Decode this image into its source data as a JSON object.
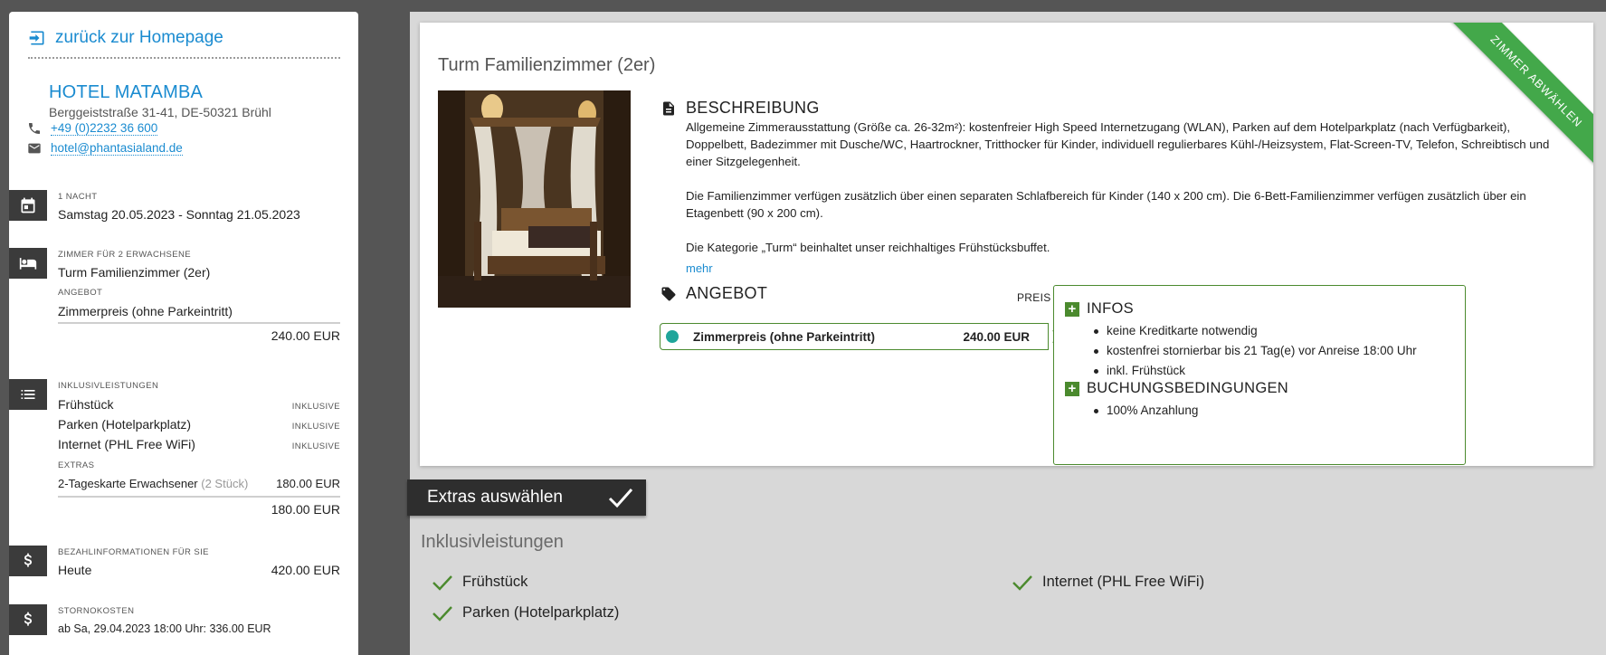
{
  "sidebar": {
    "back_link": "zurück zur Homepage",
    "hotel": {
      "name": "HOTEL MATAMBA",
      "address": "Berggeiststraße 31-41, DE-50321 Brühl",
      "phone": "+49 (0)2232 36 600",
      "email": "hotel@phantasialand.de"
    },
    "stay": {
      "label": "1 NACHT",
      "dates": "Samstag 20.05.2023 - Sonntag 21.05.2023"
    },
    "room": {
      "label": "ZIMMER FÜR 2 ERWACHSENE",
      "name": "Turm Familienzimmer (2er)",
      "offer_label": "ANGEBOT",
      "offer_name": "Zimmerpreis (ohne Parkeintritt)",
      "price": "240.00 EUR"
    },
    "inclusive": {
      "label": "INKLUSIVLEISTUNGEN",
      "items": [
        {
          "name": "Frühstück",
          "status": "INKLUSIVE"
        },
        {
          "name": "Parken (Hotelparkplatz)",
          "status": "INKLUSIVE"
        },
        {
          "name": "Internet (PHL Free WiFi)",
          "status": "INKLUSIVE"
        }
      ],
      "extras_label": "EXTRAS",
      "extras": [
        {
          "name": "2-Tageskarte Erwachsener",
          "qty": "(2 Stück)",
          "price": "180.00 EUR"
        }
      ],
      "extras_total": "180.00 EUR"
    },
    "payment": {
      "label": "BEZAHLINFORMATIONEN FÜR SIE",
      "when": "Heute",
      "amount": "420.00 EUR"
    },
    "cancellation": {
      "label": "STORNOKOSTEN",
      "text": "ab Sa, 29.04.2023 18:00 Uhr: 336.00 EUR"
    }
  },
  "room_card": {
    "title": "Turm Familienzimmer (2er)",
    "ribbon": "ZIMMER ABWÄHLEN",
    "description_heading": "BESCHREIBUNG",
    "description": [
      "Allgemeine Zimmerausstattung (Größe ca. 26-32m²): kostenfreier High Speed Internetzugang (WLAN), Parken auf dem Hotelparkplatz (nach Verfügbarkeit), Doppelbett, Badezimmer mit Dusche/WC, Haartrockner, Tritthocker für Kinder, individuell regulierbares Kühl-/Heizsystem, Flat-Screen-TV, Telefon, Schreibtisch und einer Sitzgelegenheit.",
      "Die Familienzimmer verfügen zusätzlich über einen separaten Schlafbereich für Kinder (140 x 200 cm). Die 6-Bett-Familienzimmer verfügen zusätzlich über ein Etagenbett (90 x 200 cm).",
      "Die Kategorie „Turm“ beinhaltet unser reichhaltiges Frühstücksbuffet."
    ],
    "more": "mehr",
    "offer_heading": "ANGEBOT",
    "price_for": "PREIS FÜR",
    "offer": {
      "name": "Zimmerpreis (ohne Parkeintritt)",
      "price": "240.00 EUR"
    },
    "infos": {
      "heading": "INFOS",
      "items": [
        "keine Kreditkarte notwendig",
        "kostenfrei stornierbar bis 21 Tag(e) vor Anreise 18:00 Uhr",
        "inkl. Frühstück"
      ]
    },
    "conditions": {
      "heading": "BUCHUNGSBEDINGUNGEN",
      "items": [
        "100% Anzahlung"
      ]
    }
  },
  "extras": {
    "tab": "Extras auswählen",
    "inclusive_title": "Inklusivleistungen",
    "items": [
      "Frühstück",
      "Internet (PHL Free WiFi)",
      "Parken (Hotelparkplatz)"
    ]
  },
  "colors": {
    "accent_blue": "#1a8bd0",
    "accent_green": "#4b8a2e",
    "ribbon_green": "#43a84a",
    "dot_teal": "#1fa59a"
  }
}
